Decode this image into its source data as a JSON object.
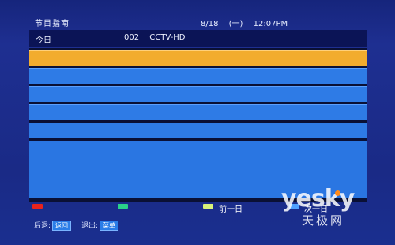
{
  "header": {
    "title": "节目指南",
    "date": "8/18",
    "weekday": "(一)",
    "time": "12:07PM"
  },
  "channel_bar": {
    "day": "今日",
    "channel_number": "002",
    "channel_name": "CCTV-HD"
  },
  "guide": {
    "rows": [
      {
        "selected": true,
        "text": ""
      },
      {
        "selected": false,
        "text": ""
      },
      {
        "selected": false,
        "text": ""
      },
      {
        "selected": false,
        "text": ""
      },
      {
        "selected": false,
        "text": ""
      },
      {
        "selected": false,
        "text": ""
      }
    ]
  },
  "color_keys": {
    "red": "#e8231c",
    "green": "#2ad28a",
    "yellow": "#d8f27a",
    "blue": "#4fa0ff",
    "yellow_label": "前一日",
    "blue_label": "次一日"
  },
  "hints": {
    "back_label": "后退:",
    "back_button": "返回",
    "exit_label": "退出:",
    "exit_button": "菜单"
  },
  "watermark": {
    "brand": "yesky",
    "sub": "天极网"
  }
}
